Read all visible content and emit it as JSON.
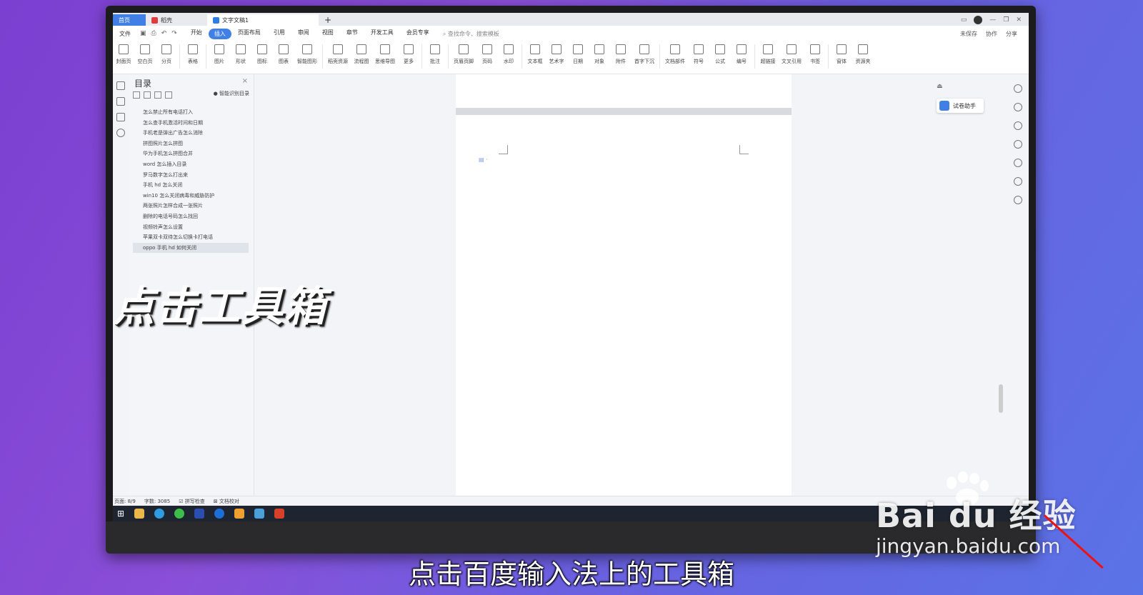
{
  "tabs": {
    "home": "首页",
    "daoke": "稻壳",
    "doc": "文字文稿1"
  },
  "menu": {
    "file": "文件",
    "items": [
      "开始",
      "插入",
      "页面布局",
      "引用",
      "审阅",
      "视图",
      "章节",
      "开发工具",
      "会员专享"
    ],
    "active_index": 1,
    "search_placeholder": "查找命令、搜索模板",
    "right": [
      "未保存",
      "协作",
      "分享"
    ]
  },
  "ribbon": [
    "封面页",
    "空白页",
    "分页",
    "表格",
    "图片",
    "形状",
    "图标",
    "图表",
    "智能图形",
    "稻壳资源",
    "流程图",
    "思维导图",
    "更多",
    "批注",
    "页眉页脚",
    "页码",
    "水印",
    "文本框",
    "艺术字",
    "日期",
    "对象",
    "附件",
    "首字下沉",
    "文档部件",
    "符号",
    "公式",
    "编号",
    "超链接",
    "文叉引用",
    "书签",
    "窗体",
    "资源夹"
  ],
  "toc": {
    "title": "目录",
    "smart": "智能识别目录",
    "items": [
      "怎么禁止所有电话打入",
      "怎么查手机激活时间和日期",
      "手机老是弹出广告怎么消除",
      "拼图照片怎么拼图",
      "华为手机怎么拼图合并",
      "word 怎么插入目录",
      "罗马数字怎么打出来",
      "手机 hd 怎么关闭",
      "win10 怎么关闭病毒和威胁防护",
      "两张照片怎样合成一张照片",
      "删除的电话号码怎么找回",
      "视频铃声怎么设置",
      "苹果双卡双待怎么切换卡打电话",
      "oppo 手机 hd 如何关闭"
    ],
    "selected_index": 13
  },
  "assistant": "试卷助手",
  "status": {
    "page": "页面: 8/9",
    "words": "字数: 3085",
    "spell": "拼写检查",
    "proof": "文档校对"
  },
  "caption": "点击工具箱",
  "subtitle": "点击百度输入法上的工具箱",
  "watermark": {
    "logo": "Bai du 经验",
    "url": "jingyan.baidu.com"
  }
}
